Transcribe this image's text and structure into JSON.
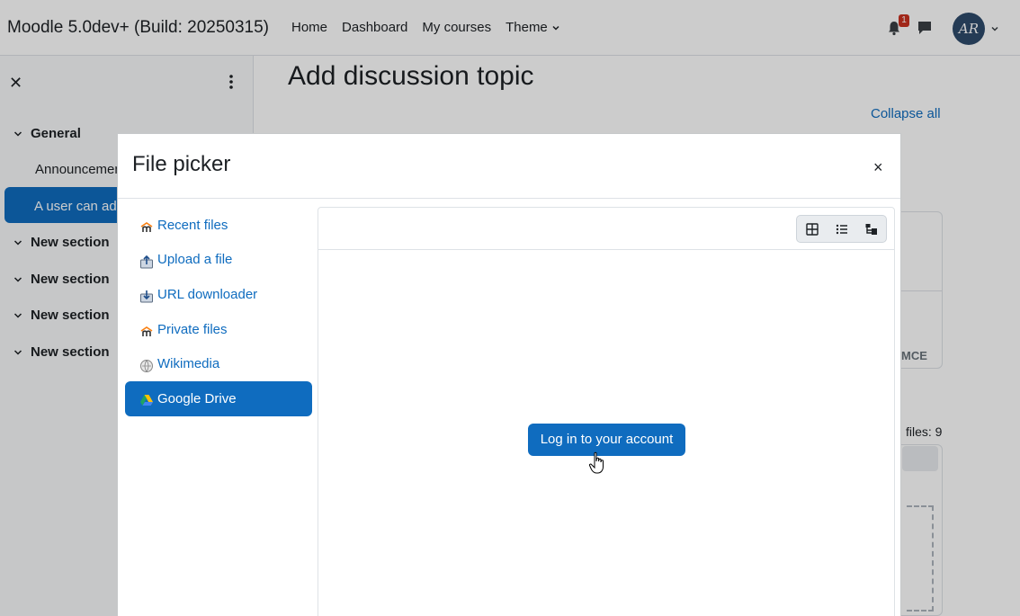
{
  "navbar": {
    "site_name": "Moodle 5.0dev+ (Build: 20250315)",
    "links": [
      "Home",
      "Dashboard",
      "My courses"
    ],
    "theme_label": "Theme",
    "notification_count": "1",
    "avatar_initials": "AR"
  },
  "drawer": {
    "close_symbol": "✕",
    "sections": [
      {
        "label": "General"
      },
      {
        "label": "New section"
      },
      {
        "label": "New section"
      },
      {
        "label": "New section"
      },
      {
        "label": "New section"
      }
    ],
    "items": [
      "Announcements",
      "A user can add"
    ]
  },
  "page": {
    "title": "Add discussion topic",
    "collapse_all": "Collapse all",
    "editor_tag": "MCE",
    "files_count_label": "files: 9"
  },
  "modal": {
    "title": "File picker",
    "close_symbol": "×",
    "repositories": [
      {
        "label": "Recent files",
        "icon": "moodle-icon"
      },
      {
        "label": "Upload a file",
        "icon": "upload-icon"
      },
      {
        "label": "URL downloader",
        "icon": "url-download-icon"
      },
      {
        "label": "Private files",
        "icon": "moodle-icon"
      },
      {
        "label": "Wikimedia",
        "icon": "wikimedia-icon"
      },
      {
        "label": "Google Drive",
        "icon": "google-drive-icon",
        "active": true
      }
    ],
    "view_buttons": [
      "icons-view-icon",
      "list-view-icon",
      "tree-view-icon"
    ],
    "login_button": "Log in to your account"
  },
  "colors": {
    "primary": "#0f6cbf",
    "badge": "#ca3120",
    "backdrop": "rgba(0,0,0,0.2)"
  }
}
